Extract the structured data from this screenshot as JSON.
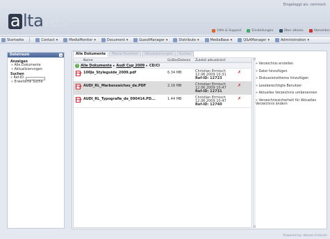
{
  "header": {
    "logo_part1": "a",
    "logo_part2": "lta",
    "logo_part3": "res",
    "login_text": "Eingeloggt als: cermisch",
    "links": [
      {
        "label": "Hilfe & Support",
        "icon": "help-icon",
        "color": "#d63"
      },
      {
        "label": "Einstellungen",
        "icon": "settings-icon",
        "color": "#4a6"
      },
      {
        "label": "Über altares",
        "icon": "info-icon",
        "color": "#356"
      },
      {
        "label": "Abmelden",
        "icon": "logout-icon",
        "color": "#c33"
      }
    ]
  },
  "menu": [
    {
      "label": "Startseite",
      "icon": "home-icon"
    },
    {
      "label": "Contact",
      "icon": "contact-icon",
      "dropdown": "▾"
    },
    {
      "label": "MediaMonitor",
      "icon": "monitor-icon",
      "dropdown": "▾"
    },
    {
      "label": "Document",
      "icon": "document-icon",
      "dropdown": "▾"
    },
    {
      "label": "GuestManager",
      "icon": "guest-icon",
      "dropdown": "▾"
    },
    {
      "label": "Distribute",
      "icon": "distribute-icon",
      "dropdown": "▾"
    },
    {
      "label": "MediaBase",
      "icon": "mediabase-icon",
      "dropdown": "▾"
    },
    {
      "label": "Q&AManager",
      "icon": "qa-icon",
      "dropdown": "▾"
    },
    {
      "label": "Administration",
      "icon": "admin-icon",
      "dropdown": "▾"
    }
  ],
  "sidebar": {
    "title": "Dateiraum",
    "sections": [
      {
        "heading": "Anzeigen",
        "items": [
          "» Alle Dokumente",
          "» Aktualisierungen"
        ]
      },
      {
        "heading": "Suchen",
        "items": [
          "» Erweiterte Suche"
        ]
      }
    ],
    "ref_label": "» Ref-ID:",
    "ref_value": ""
  },
  "tabs": [
    {
      "label": "Alle Dokumente",
      "active": true
    },
    {
      "label": "Meine Favoriten",
      "active": false
    },
    {
      "label": "Aktualisierungen",
      "active": false
    },
    {
      "label": "Suchen",
      "active": false
    }
  ],
  "columns": {
    "name": "Name",
    "size": "Größe/Dateien",
    "last": "Zuletzt aktualisiert"
  },
  "breadcrumb": {
    "part1": "Alle Dokumente",
    "sep1": "▸",
    "part2": "Audi Cup 2009",
    "sep2": "▸",
    "part3": "CD/CI"
  },
  "files": [
    {
      "name": "100Je_Styleguide_2009.pdf",
      "size": "6.34 MB",
      "user": "Christian Ermisch",
      "date": "12.06.2009 10:31",
      "ref": "Ref-ID: 12723"
    },
    {
      "name": "AUDI_RL_Markenzeiches_de.PDF",
      "size": "2.16 MB",
      "user": "Christian Ermisch",
      "date": "12.06.2009 10:47",
      "ref": "Ref-ID: 12731"
    },
    {
      "name": "AUDI_RL_Typografie_de_090414.PD...",
      "size": "1.44 MB",
      "user": "Christian Ermisch",
      "date": "12.06.2009 10:47",
      "ref": "Ref-ID: 12740"
    }
  ],
  "actions": [
    "» Verzeichnis erstellen",
    "» Datei hinzufügen",
    "» Diskussionsthema hinzufügen",
    "» Leseberechtigte Benutzer",
    "» Aktuelles Verzeichnis umbenennen",
    "» Verzeichnissicherheit für Aktuelles Verzeichnis ändern"
  ],
  "footer": "Powered by: altares Ermisch"
}
